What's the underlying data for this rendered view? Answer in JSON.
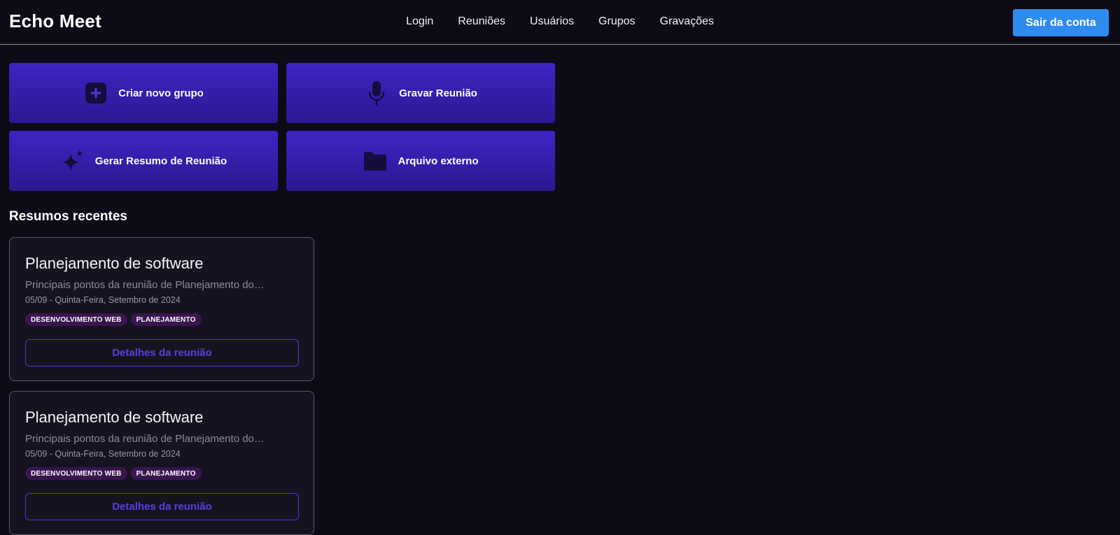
{
  "app": {
    "brand": "Echo Meet"
  },
  "nav": {
    "links": [
      "Login",
      "Reuniões",
      "Usuários",
      "Grupos",
      "Gravações"
    ],
    "logout_label": "Sair da conta"
  },
  "actions": [
    {
      "label": "Criar novo grupo",
      "icon": "plus-square-icon"
    },
    {
      "label": "Gravar Reunião",
      "icon": "microphone-icon"
    },
    {
      "label": "Gerar Resumo de Reunião",
      "icon": "sparkles-icon"
    },
    {
      "label": "Arquivo externo",
      "icon": "folder-icon"
    }
  ],
  "recent": {
    "heading": "Resumos recentes",
    "items": [
      {
        "title": "Planejamento de software",
        "description": "Principais pontos da reunião de Planejamento do…",
        "date": "05/09 - Quinta-Feira, Setembro de 2024",
        "tags": [
          "DESENVOLVIMENTO WEB",
          "PLANEJAMENTO"
        ],
        "button_label": "Detalhes da reunião"
      },
      {
        "title": "Planejamento de software",
        "description": "Principais pontos da reunião de Planejamento do…",
        "date": "05/09 - Quinta-Feira, Setembro de 2024",
        "tags": [
          "DESENVOLVIMENTO WEB",
          "PLANEJAMENTO"
        ],
        "button_label": "Detalhes da reunião"
      }
    ]
  },
  "colors": {
    "background": "#0c0b16",
    "accent_blue": "#2e8cf0",
    "action_gradient_top": "#3f24c4",
    "action_gradient_bottom": "#2b1890",
    "tag_background": "#3a1550",
    "details_button": "#5a3fe0"
  }
}
